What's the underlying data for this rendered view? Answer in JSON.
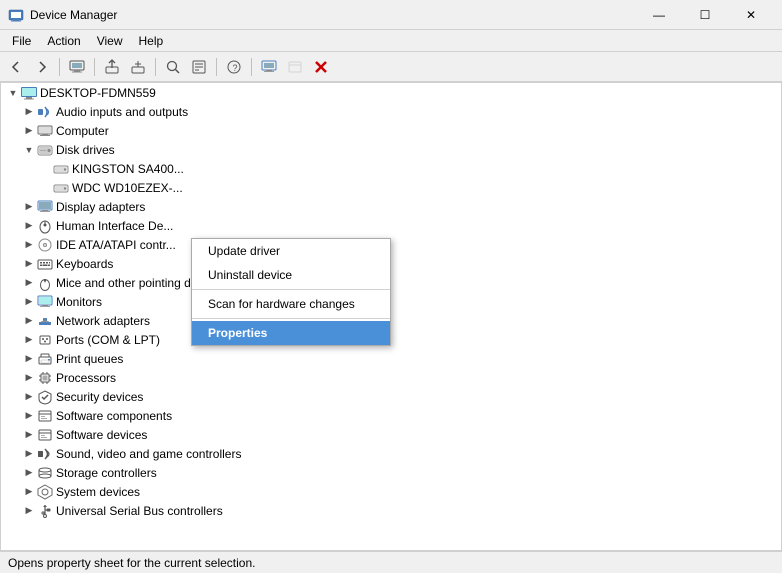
{
  "window": {
    "title": "Device Manager",
    "title_icon": "⚙"
  },
  "title_buttons": {
    "minimize": "—",
    "restore": "☐",
    "close": "✕"
  },
  "menu": {
    "items": [
      "File",
      "Action",
      "View",
      "Help"
    ]
  },
  "toolbar": {
    "buttons": [
      {
        "name": "back-button",
        "icon": "←",
        "disabled": false
      },
      {
        "name": "forward-button",
        "icon": "→",
        "disabled": false
      },
      {
        "name": "computer-properties-button",
        "icon": "🖥",
        "disabled": false
      },
      {
        "name": "update-driver-button",
        "icon": "↑",
        "disabled": false
      },
      {
        "name": "uninstall-button",
        "icon": "✕",
        "disabled": false
      },
      {
        "name": "scan-hardware-button",
        "icon": "🔍",
        "disabled": false
      },
      {
        "name": "properties-button",
        "icon": "≡",
        "disabled": false
      },
      {
        "name": "help-button",
        "icon": "?",
        "disabled": false
      }
    ]
  },
  "tree": {
    "root": "DESKTOP-FDMN559",
    "items": [
      {
        "id": "root",
        "label": "DESKTOP-FDMN559",
        "indent": 0,
        "expanded": true,
        "type": "computer",
        "icon": "💻"
      },
      {
        "id": "audio",
        "label": "Audio inputs and outputs",
        "indent": 1,
        "expanded": false,
        "type": "device",
        "icon": "🔊"
      },
      {
        "id": "computer",
        "label": "Computer",
        "indent": 1,
        "expanded": false,
        "type": "computer",
        "icon": "🖥"
      },
      {
        "id": "diskdrives",
        "label": "Disk drives",
        "indent": 1,
        "expanded": true,
        "type": "folder",
        "icon": "💾"
      },
      {
        "id": "kingston",
        "label": "KINGSTON SA400...",
        "indent": 2,
        "expanded": false,
        "type": "device",
        "icon": "💾"
      },
      {
        "id": "wdc",
        "label": "WDC WD10EZEX-...",
        "indent": 2,
        "expanded": false,
        "type": "device",
        "icon": "💾"
      },
      {
        "id": "displayadapters",
        "label": "Display adapters",
        "indent": 1,
        "expanded": false,
        "type": "device",
        "icon": "🖥"
      },
      {
        "id": "humaninterface",
        "label": "Human Interface De...",
        "indent": 1,
        "expanded": false,
        "type": "device",
        "icon": "🖱"
      },
      {
        "id": "ideata",
        "label": "IDE ATA/ATAPI contr...",
        "indent": 1,
        "expanded": false,
        "type": "device",
        "icon": "📀"
      },
      {
        "id": "keyboards",
        "label": "Keyboards",
        "indent": 1,
        "expanded": false,
        "type": "device",
        "icon": "⌨"
      },
      {
        "id": "mice",
        "label": "Mice and other pointing devices",
        "indent": 1,
        "expanded": false,
        "type": "device",
        "icon": "🖱"
      },
      {
        "id": "monitors",
        "label": "Monitors",
        "indent": 1,
        "expanded": false,
        "type": "device",
        "icon": "🖥"
      },
      {
        "id": "network",
        "label": "Network adapters",
        "indent": 1,
        "expanded": false,
        "type": "device",
        "icon": "🌐"
      },
      {
        "id": "ports",
        "label": "Ports (COM & LPT)",
        "indent": 1,
        "expanded": false,
        "type": "device",
        "icon": "🔌"
      },
      {
        "id": "printqueues",
        "label": "Print queues",
        "indent": 1,
        "expanded": false,
        "type": "device",
        "icon": "🖨"
      },
      {
        "id": "processors",
        "label": "Processors",
        "indent": 1,
        "expanded": false,
        "type": "device",
        "icon": "⚙"
      },
      {
        "id": "security",
        "label": "Security devices",
        "indent": 1,
        "expanded": false,
        "type": "device",
        "icon": "🔒"
      },
      {
        "id": "softwarecomponents",
        "label": "Software components",
        "indent": 1,
        "expanded": false,
        "type": "device",
        "icon": "📦"
      },
      {
        "id": "softwaredevices",
        "label": "Software devices",
        "indent": 1,
        "expanded": false,
        "type": "device",
        "icon": "📦"
      },
      {
        "id": "soundvideo",
        "label": "Sound, video and game controllers",
        "indent": 1,
        "expanded": false,
        "type": "device",
        "icon": "🎵"
      },
      {
        "id": "storage",
        "label": "Storage controllers",
        "indent": 1,
        "expanded": false,
        "type": "device",
        "icon": "💾"
      },
      {
        "id": "systemdevices",
        "label": "System devices",
        "indent": 1,
        "expanded": false,
        "type": "device",
        "icon": "⚙"
      },
      {
        "id": "usb",
        "label": "Universal Serial Bus controllers",
        "indent": 1,
        "expanded": false,
        "type": "device",
        "icon": "🔌"
      }
    ]
  },
  "context_menu": {
    "items": [
      {
        "label": "Update driver",
        "action": "update-driver"
      },
      {
        "label": "Uninstall device",
        "action": "uninstall-device"
      },
      {
        "label": "Scan for hardware changes",
        "action": "scan-hardware"
      },
      {
        "label": "Properties",
        "action": "properties",
        "highlighted": true
      }
    ]
  },
  "status_bar": {
    "text": "Opens property sheet for the current selection."
  }
}
